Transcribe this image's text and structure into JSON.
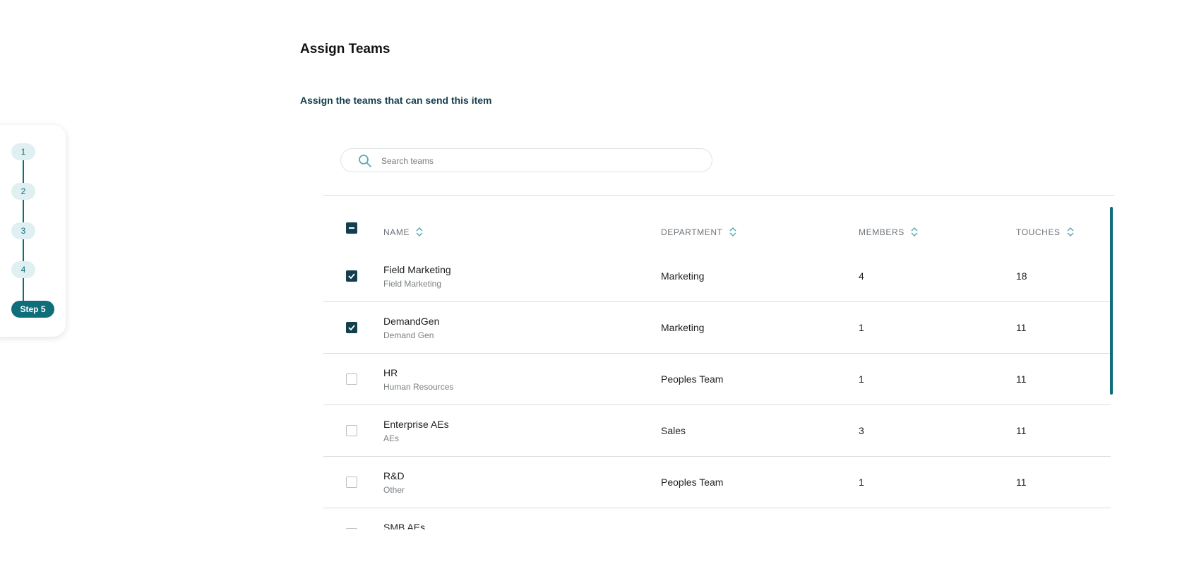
{
  "page": {
    "title": "Assign Teams",
    "subtitle": "Assign the teams that can send this item"
  },
  "stepper": {
    "steps": [
      "1",
      "2",
      "3",
      "4",
      "Step 5"
    ],
    "active_index": 4
  },
  "search": {
    "placeholder": "Search teams",
    "value": ""
  },
  "table": {
    "headers": {
      "name": "NAME",
      "department": "DEPARTMENT",
      "members": "MEMBERS",
      "touches": "TOUCHES"
    },
    "select_all_state": "indeterminate",
    "rows": [
      {
        "name": "Field Marketing",
        "sub": "Field Marketing",
        "department": "Marketing",
        "members": "4",
        "touches": "18",
        "checked": true
      },
      {
        "name": "DemandGen",
        "sub": "Demand Gen",
        "department": "Marketing",
        "members": "1",
        "touches": "11",
        "checked": true
      },
      {
        "name": "HR",
        "sub": "Human Resources",
        "department": "Peoples Team",
        "members": "1",
        "touches": "11",
        "checked": false
      },
      {
        "name": "Enterprise AEs",
        "sub": "AEs",
        "department": "Sales",
        "members": "3",
        "touches": "11",
        "checked": false
      },
      {
        "name": "R&D",
        "sub": "Other",
        "department": "Peoples Team",
        "members": "1",
        "touches": "11",
        "checked": false
      },
      {
        "name": "SMB AEs",
        "sub": "",
        "department": "",
        "members": "",
        "touches": "",
        "checked": false
      }
    ]
  },
  "colors": {
    "accent": "#0f6e7a",
    "dark": "#123e4d"
  },
  "icons": {
    "search": "search-icon",
    "sort": "sort-icon",
    "check": "check-icon",
    "minus": "minus-icon"
  }
}
